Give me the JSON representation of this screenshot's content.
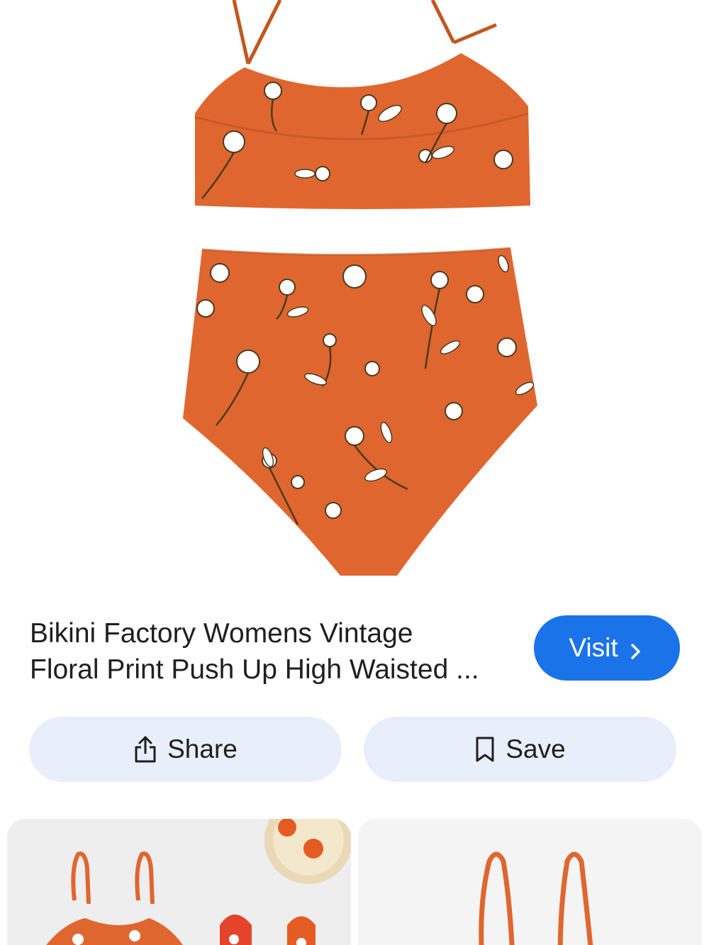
{
  "result": {
    "title_line1": "Bikini Factory Womens Vintage",
    "title_line2": "Floral Print Push Up High Waisted ...",
    "visit_label": "Visit"
  },
  "actions": {
    "share_label": "Share",
    "save_label": "Save"
  },
  "icons": {
    "visit": "chevron-right-icon",
    "share": "share-icon",
    "save": "bookmark-icon"
  },
  "colors": {
    "primary": "#1a73e8",
    "tonal_button": "#e8effb",
    "swimsuit_orange": "#e0662f"
  }
}
